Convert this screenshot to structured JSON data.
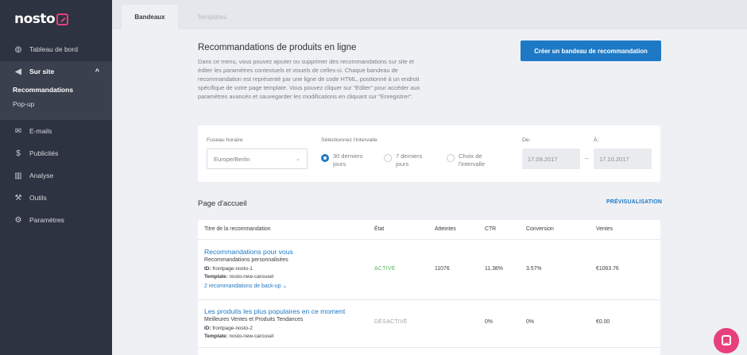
{
  "brand": {
    "logo_text": "nosto",
    "accent": "#e8407a",
    "primary": "#1d79c5",
    "sidebar_bg": "#2d3340"
  },
  "sidebar": {
    "items": [
      {
        "label": "Tableau de bord",
        "icon": "dashboard-icon"
      },
      {
        "label": "Sur site",
        "icon": "megaphone-icon"
      },
      {
        "label": "E-mails",
        "icon": "envelope-icon"
      },
      {
        "label": "Publicités",
        "icon": "dollar-icon"
      },
      {
        "label": "Analyse",
        "icon": "bar-chart-icon"
      },
      {
        "label": "Outils",
        "icon": "wrench-icon"
      },
      {
        "label": "Paramètres",
        "icon": "gear-icon"
      }
    ],
    "sub_items": [
      {
        "label": "Recommandations"
      },
      {
        "label": "Pop-up"
      }
    ]
  },
  "tabs": [
    {
      "label": "Bandeaux"
    },
    {
      "label": "Templates"
    }
  ],
  "intro": {
    "title": "Recommandations de produits en ligne",
    "text": "Dans ce menu, vous pouvez ajouter ou supprimer des recommandations sur site et éditer les paramètres contextuels et visuels de celles-ci. Chaque bandeau de recommandation est représenté par une ligne de code HTML, positionné à un endroit spécifique de votre page template. Vous pouvez cliquer sur \"Editer\" pour accéder aux paramètres avancés et sauvegarder les modifications en cliquant sur \"Enregistrer\".",
    "cta_label": "Créer un bandeau de recommandation"
  },
  "filters": {
    "timezone_label": "Fuseau horaire",
    "timezone_value": "Europe/Berlin",
    "interval_label": "Sélectionnez l'intervalle",
    "options": [
      {
        "label_line1": "30 derniers",
        "label_line2": "jours",
        "selected": true
      },
      {
        "label_line1": "7 derniers",
        "label_line2": "jours",
        "selected": false
      },
      {
        "label_line1": "Choix de",
        "label_line2": "l'intervalle",
        "selected": false
      }
    ],
    "from_label": "De:",
    "from_value": "17.09.2017",
    "to_label": "À:",
    "to_value": "17.10.2017",
    "dash": "–"
  },
  "section": {
    "title": "Page d'accueil",
    "preview_label": "PRÉVISUALISATION"
  },
  "table": {
    "headers": [
      "Titre de la recommandation",
      "État",
      "Atteintes",
      "CTR",
      "Conversion",
      "Ventes"
    ],
    "rows": [
      {
        "title": "Recommandations pour vous",
        "subtitle": "Recommandations personnalisées",
        "id_label": "ID:",
        "id_value": "frontpage-nosto-1",
        "template_label": "Template:",
        "template_value": "nosto-new-carousel",
        "backup": "2 recommandations de back-up",
        "status": "ACTIVÉ",
        "reach": "11076",
        "ctr": "11.38%",
        "conversion": "3.57%",
        "sales": "€1063.76"
      },
      {
        "title": "Les produits les plus populaires en ce moment",
        "subtitle": "Meilleures Ventes et Produits Tendances",
        "id_label": "ID:",
        "id_value": "frontpage-nosto-2",
        "template_label": "Template:",
        "template_value": "nosto-new-carousel",
        "status": "DÉSACTIVÉ",
        "reach": "",
        "ctr": "0%",
        "conversion": "0%",
        "sales": "€0.00"
      }
    ]
  },
  "chat": {
    "icon": "chat-icon"
  }
}
